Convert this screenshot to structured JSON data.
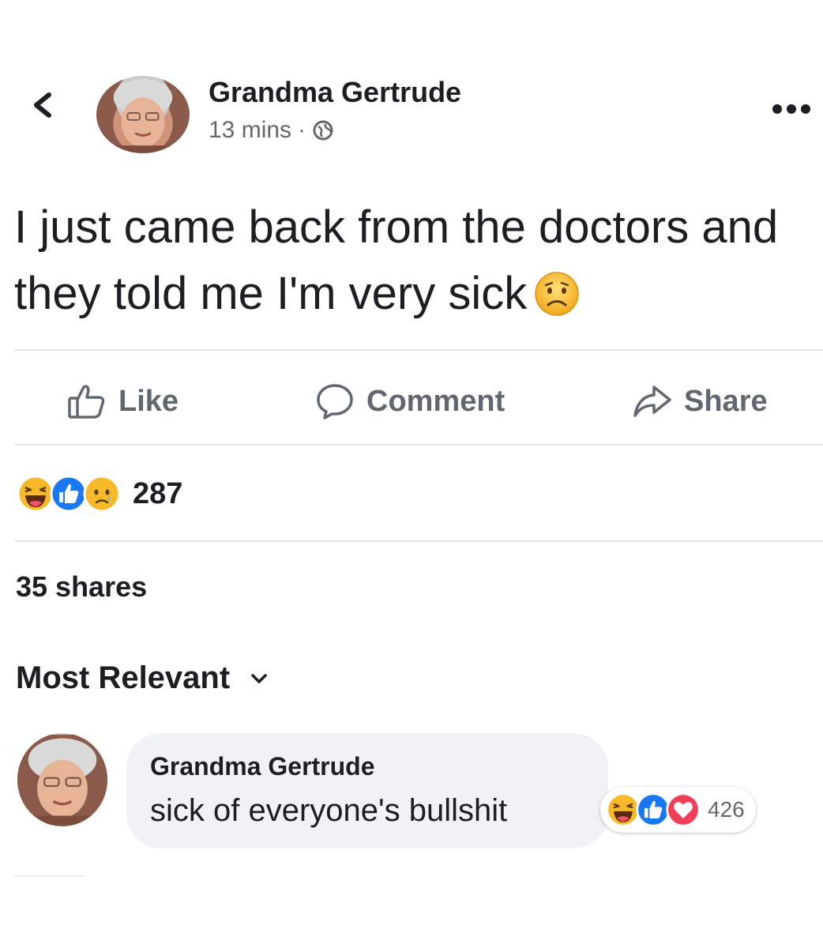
{
  "post": {
    "author": "Grandma Gertrude",
    "timestamp": "13 mins",
    "separator": "·",
    "audience_icon": "globe-icon",
    "text": "I just came back from the doctors and they told me I'm very sick",
    "emoji": "sad-face-emoji"
  },
  "actions": {
    "like": "Like",
    "comment": "Comment",
    "share": "Share"
  },
  "reactions": {
    "icons": [
      "haha-reaction-icon",
      "like-reaction-icon",
      "sad-reaction-icon"
    ],
    "count": "287"
  },
  "shares": "35 shares",
  "comments_filter": "Most Relevant",
  "comment": {
    "author": "Grandma Gertrude",
    "text": "sick of everyone's bullshit",
    "reaction_icons": [
      "haha-reaction-icon",
      "like-reaction-icon",
      "love-reaction-icon"
    ],
    "reaction_count": "426"
  },
  "colors": {
    "primary_text": "#1c1e21",
    "secondary_text": "#65676b",
    "like_blue": "#1877f2",
    "love_red": "#f33e58",
    "emoji_yellow": "#f7b928",
    "comment_bubble": "#f0f2f5"
  }
}
